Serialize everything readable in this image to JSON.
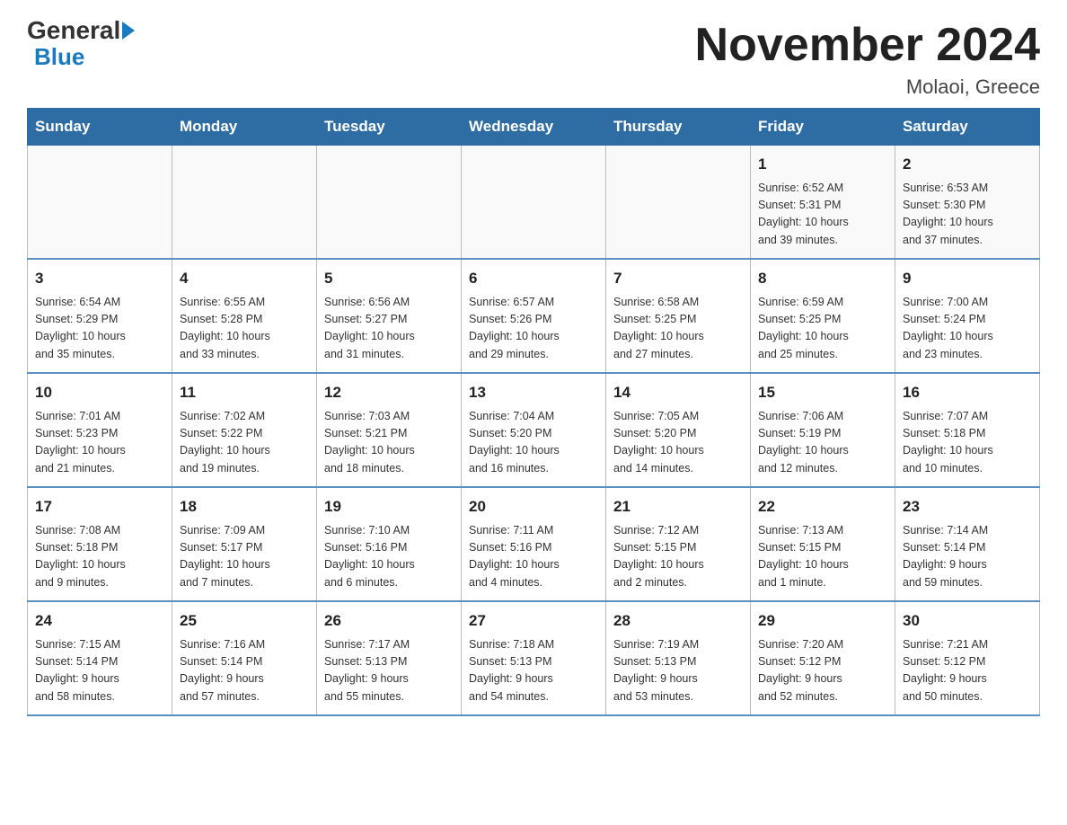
{
  "logo": {
    "text_general": "General",
    "text_blue": "Blue"
  },
  "title": "November 2024",
  "subtitle": "Molaoi, Greece",
  "days_of_week": [
    "Sunday",
    "Monday",
    "Tuesday",
    "Wednesday",
    "Thursday",
    "Friday",
    "Saturday"
  ],
  "weeks": [
    {
      "cells": [
        {
          "day": "",
          "info": ""
        },
        {
          "day": "",
          "info": ""
        },
        {
          "day": "",
          "info": ""
        },
        {
          "day": "",
          "info": ""
        },
        {
          "day": "",
          "info": ""
        },
        {
          "day": "1",
          "info": "Sunrise: 6:52 AM\nSunset: 5:31 PM\nDaylight: 10 hours\nand 39 minutes."
        },
        {
          "day": "2",
          "info": "Sunrise: 6:53 AM\nSunset: 5:30 PM\nDaylight: 10 hours\nand 37 minutes."
        }
      ]
    },
    {
      "cells": [
        {
          "day": "3",
          "info": "Sunrise: 6:54 AM\nSunset: 5:29 PM\nDaylight: 10 hours\nand 35 minutes."
        },
        {
          "day": "4",
          "info": "Sunrise: 6:55 AM\nSunset: 5:28 PM\nDaylight: 10 hours\nand 33 minutes."
        },
        {
          "day": "5",
          "info": "Sunrise: 6:56 AM\nSunset: 5:27 PM\nDaylight: 10 hours\nand 31 minutes."
        },
        {
          "day": "6",
          "info": "Sunrise: 6:57 AM\nSunset: 5:26 PM\nDaylight: 10 hours\nand 29 minutes."
        },
        {
          "day": "7",
          "info": "Sunrise: 6:58 AM\nSunset: 5:25 PM\nDaylight: 10 hours\nand 27 minutes."
        },
        {
          "day": "8",
          "info": "Sunrise: 6:59 AM\nSunset: 5:25 PM\nDaylight: 10 hours\nand 25 minutes."
        },
        {
          "day": "9",
          "info": "Sunrise: 7:00 AM\nSunset: 5:24 PM\nDaylight: 10 hours\nand 23 minutes."
        }
      ]
    },
    {
      "cells": [
        {
          "day": "10",
          "info": "Sunrise: 7:01 AM\nSunset: 5:23 PM\nDaylight: 10 hours\nand 21 minutes."
        },
        {
          "day": "11",
          "info": "Sunrise: 7:02 AM\nSunset: 5:22 PM\nDaylight: 10 hours\nand 19 minutes."
        },
        {
          "day": "12",
          "info": "Sunrise: 7:03 AM\nSunset: 5:21 PM\nDaylight: 10 hours\nand 18 minutes."
        },
        {
          "day": "13",
          "info": "Sunrise: 7:04 AM\nSunset: 5:20 PM\nDaylight: 10 hours\nand 16 minutes."
        },
        {
          "day": "14",
          "info": "Sunrise: 7:05 AM\nSunset: 5:20 PM\nDaylight: 10 hours\nand 14 minutes."
        },
        {
          "day": "15",
          "info": "Sunrise: 7:06 AM\nSunset: 5:19 PM\nDaylight: 10 hours\nand 12 minutes."
        },
        {
          "day": "16",
          "info": "Sunrise: 7:07 AM\nSunset: 5:18 PM\nDaylight: 10 hours\nand 10 minutes."
        }
      ]
    },
    {
      "cells": [
        {
          "day": "17",
          "info": "Sunrise: 7:08 AM\nSunset: 5:18 PM\nDaylight: 10 hours\nand 9 minutes."
        },
        {
          "day": "18",
          "info": "Sunrise: 7:09 AM\nSunset: 5:17 PM\nDaylight: 10 hours\nand 7 minutes."
        },
        {
          "day": "19",
          "info": "Sunrise: 7:10 AM\nSunset: 5:16 PM\nDaylight: 10 hours\nand 6 minutes."
        },
        {
          "day": "20",
          "info": "Sunrise: 7:11 AM\nSunset: 5:16 PM\nDaylight: 10 hours\nand 4 minutes."
        },
        {
          "day": "21",
          "info": "Sunrise: 7:12 AM\nSunset: 5:15 PM\nDaylight: 10 hours\nand 2 minutes."
        },
        {
          "day": "22",
          "info": "Sunrise: 7:13 AM\nSunset: 5:15 PM\nDaylight: 10 hours\nand 1 minute."
        },
        {
          "day": "23",
          "info": "Sunrise: 7:14 AM\nSunset: 5:14 PM\nDaylight: 9 hours\nand 59 minutes."
        }
      ]
    },
    {
      "cells": [
        {
          "day": "24",
          "info": "Sunrise: 7:15 AM\nSunset: 5:14 PM\nDaylight: 9 hours\nand 58 minutes."
        },
        {
          "day": "25",
          "info": "Sunrise: 7:16 AM\nSunset: 5:14 PM\nDaylight: 9 hours\nand 57 minutes."
        },
        {
          "day": "26",
          "info": "Sunrise: 7:17 AM\nSunset: 5:13 PM\nDaylight: 9 hours\nand 55 minutes."
        },
        {
          "day": "27",
          "info": "Sunrise: 7:18 AM\nSunset: 5:13 PM\nDaylight: 9 hours\nand 54 minutes."
        },
        {
          "day": "28",
          "info": "Sunrise: 7:19 AM\nSunset: 5:13 PM\nDaylight: 9 hours\nand 53 minutes."
        },
        {
          "day": "29",
          "info": "Sunrise: 7:20 AM\nSunset: 5:12 PM\nDaylight: 9 hours\nand 52 minutes."
        },
        {
          "day": "30",
          "info": "Sunrise: 7:21 AM\nSunset: 5:12 PM\nDaylight: 9 hours\nand 50 minutes."
        }
      ]
    }
  ]
}
